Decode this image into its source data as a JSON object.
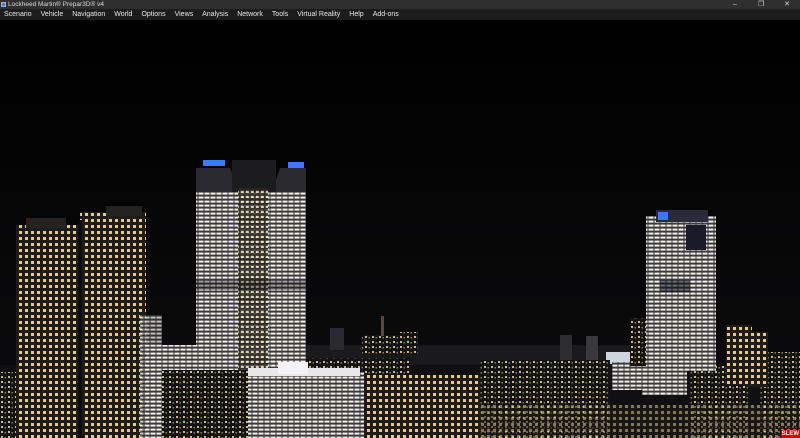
{
  "window": {
    "title": "Lockheed Martin® Prepar3D® v4",
    "minimize_glyph": "–",
    "restore_glyph": "❐",
    "close_glyph": "✕"
  },
  "menu": {
    "items": [
      {
        "label": "Scenario"
      },
      {
        "label": "Vehicle"
      },
      {
        "label": "Navigation"
      },
      {
        "label": "World"
      },
      {
        "label": "Options"
      },
      {
        "label": "Views"
      },
      {
        "label": "Analysis"
      },
      {
        "label": "Network"
      },
      {
        "label": "Tools"
      },
      {
        "label": "Virtual Reality"
      },
      {
        "label": "Help"
      },
      {
        "label": "Add-ons"
      }
    ]
  },
  "status": {
    "slew_label": "SLEW",
    "slew_color": "#d40000"
  },
  "scene": {
    "sky_color": "#000000",
    "window_light_color": "#f1e6c8",
    "roof_beacon_color": "#3c78ff"
  }
}
